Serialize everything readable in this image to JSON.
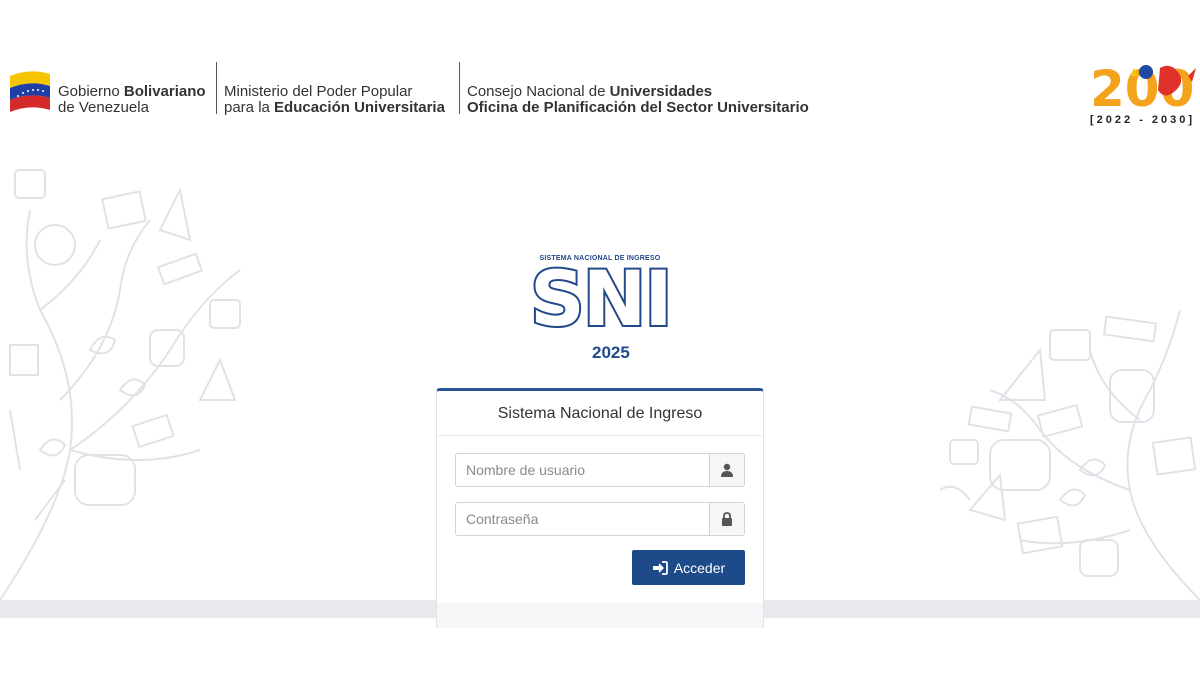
{
  "header": {
    "org1": {
      "prefix": "Gobierno ",
      "bold": "Bolivariano",
      "line2": "de Venezuela"
    },
    "org2": {
      "line1": "Ministerio del Poder Popular",
      "prefix": "para la ",
      "bold": "Educación Universitaria"
    },
    "org3": {
      "prefix": "Consejo Nacional de ",
      "bold": "Universidades",
      "line2": "Oficina de Planificación del Sector Universitario"
    },
    "years": "[2022 - 2030]",
    "logo_number": "200"
  },
  "logo": {
    "top_text": "SISTEMA NACIONAL DE INGRESO",
    "acronym": "SNI",
    "year": "2025"
  },
  "login": {
    "title": "Sistema Nacional de Ingreso",
    "username_placeholder": "Nombre de usuario",
    "password_placeholder": "Contraseña",
    "username_value": "",
    "password_value": "",
    "submit_label": "Acceder",
    "icons": {
      "username": "user-icon",
      "password": "lock-icon",
      "submit": "sign-in-icon"
    }
  },
  "colors": {
    "primary": "#1d4a89",
    "accent": "#24498a",
    "band": "#e7e9ed"
  }
}
